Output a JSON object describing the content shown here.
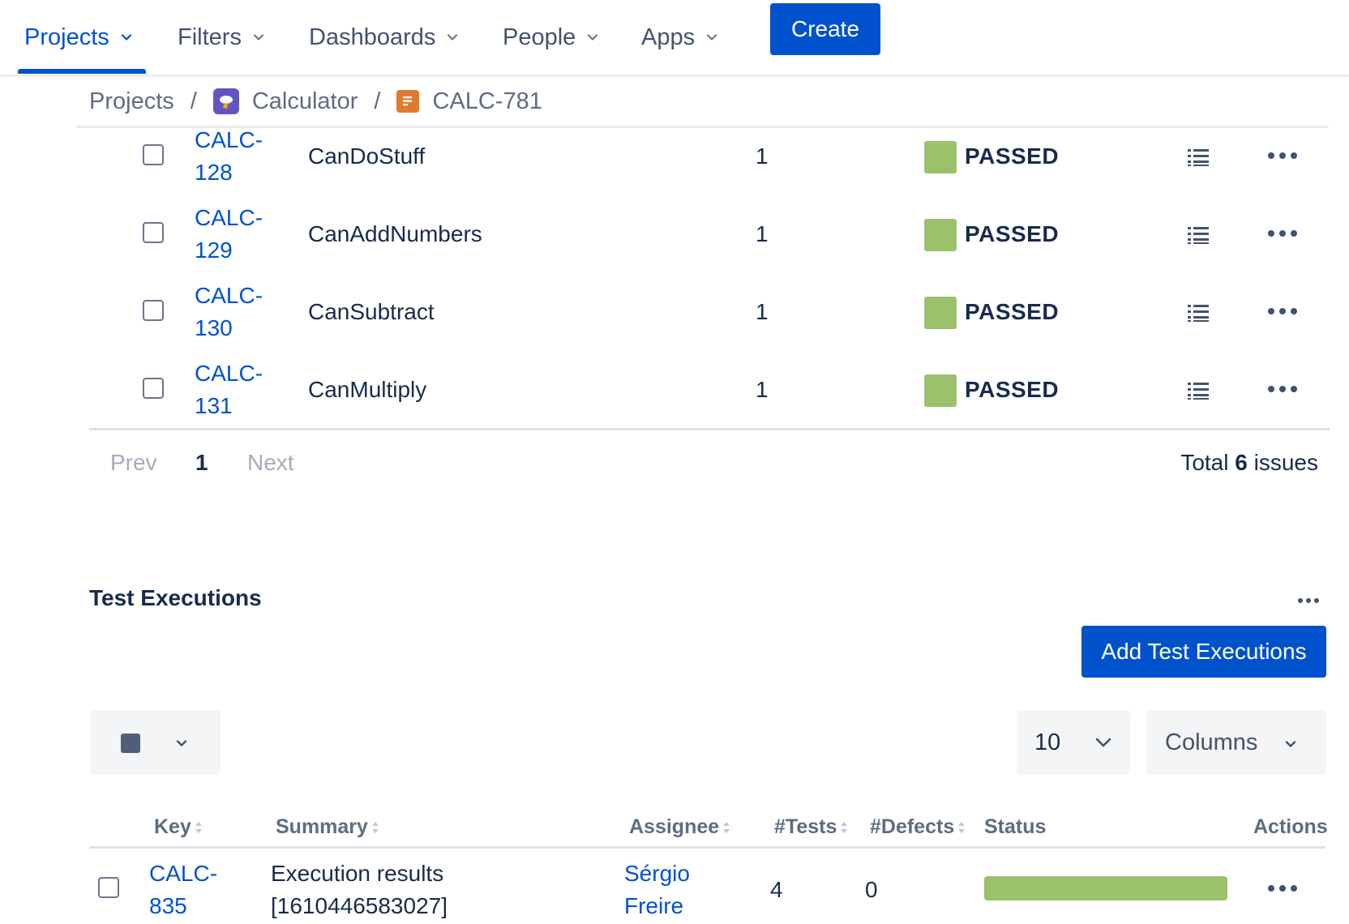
{
  "nav": {
    "items": [
      {
        "label": "Projects",
        "active": true
      },
      {
        "label": "Filters",
        "active": false
      },
      {
        "label": "Dashboards",
        "active": false
      },
      {
        "label": "People",
        "active": false
      },
      {
        "label": "Apps",
        "active": false
      }
    ],
    "create_label": "Create"
  },
  "breadcrumb": {
    "root": "Projects",
    "project": "Calculator",
    "issue": "CALC-781",
    "separator": "/"
  },
  "tests": {
    "rows": [
      {
        "key_line1": "CALC-",
        "key_line2": "128",
        "summary": "CanDoStuff",
        "count": "1",
        "status": "PASSED"
      },
      {
        "key_line1": "CALC-",
        "key_line2": "129",
        "summary": "CanAddNumbers",
        "count": "1",
        "status": "PASSED"
      },
      {
        "key_line1": "CALC-",
        "key_line2": "130",
        "summary": "CanSubtract",
        "count": "1",
        "status": "PASSED"
      },
      {
        "key_line1": "CALC-",
        "key_line2": "131",
        "summary": "CanMultiply",
        "count": "1",
        "status": "PASSED"
      }
    ],
    "pager": {
      "prev": "Prev",
      "page": "1",
      "next": "Next"
    },
    "total_prefix": "Total",
    "total_count": "6",
    "total_suffix": "issues",
    "status_color": "#9cc16d"
  },
  "executions": {
    "title": "Test Executions",
    "add_label": "Add Test Executions",
    "page_size": "10",
    "columns_label": "Columns",
    "headers": {
      "key": "Key",
      "summary": "Summary",
      "assignee": "Assignee",
      "tests": "#Tests",
      "defects": "#Defects",
      "status": "Status",
      "actions": "Actions"
    },
    "rows": [
      {
        "key_line1": "CALC-",
        "key_line2": "835",
        "summary_line1": "Execution results",
        "summary_line2": "[1610446583027]",
        "assignee_line1": "Sérgio",
        "assignee_line2": "Freire",
        "tests": "4",
        "defects": "0",
        "status_passed_fraction": 1.0
      }
    ]
  },
  "colors": {
    "brand_blue": "#0052cc",
    "passed_green": "#9cc16d",
    "text_dark": "#172b4d"
  }
}
